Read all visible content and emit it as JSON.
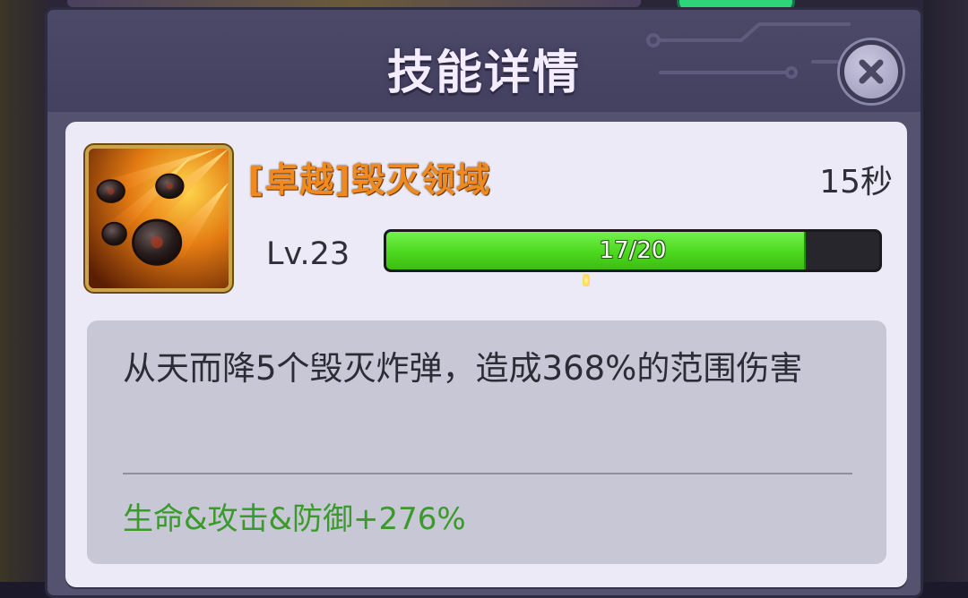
{
  "dialog": {
    "title": "技能详情"
  },
  "skill": {
    "name": "[卓越]毁灭领域",
    "cooldown": "15秒",
    "level": "Lv.23",
    "progress": {
      "current": 17,
      "max": 20,
      "label": "17/20",
      "fraction": 0.85
    },
    "description": "从天而降5个毁灭炸弹，造成368%的范围伤害",
    "bonus": "生命&攻击&防御+276%"
  },
  "icons": {
    "close": "close-icon",
    "skill": "meteor-bomb-icon"
  },
  "colors": {
    "skill_name": "#f08a1e",
    "progress_fill": "#4cd81e",
    "bonus_text": "#3a9a2a",
    "panel_header": "#4c4968"
  }
}
